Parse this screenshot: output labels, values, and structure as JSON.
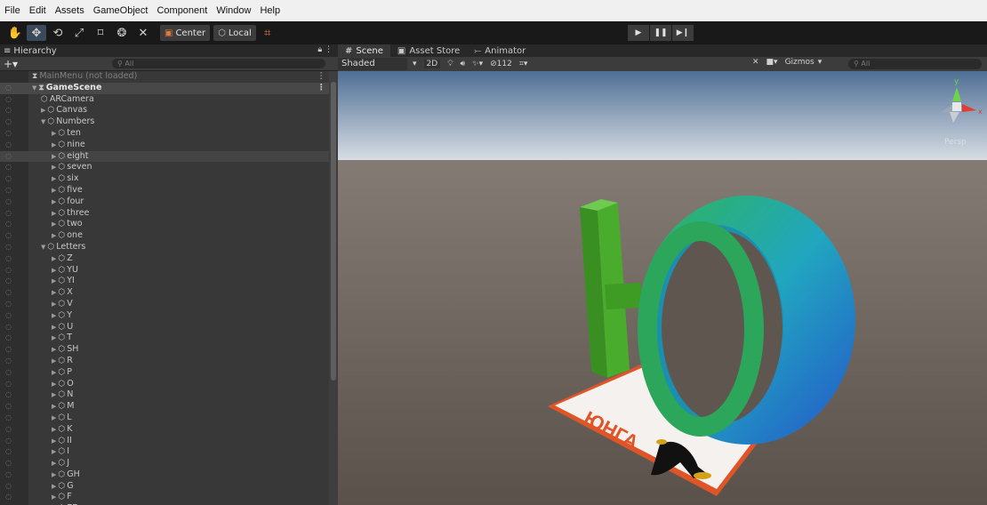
{
  "menu": [
    "File",
    "Edit",
    "Assets",
    "GameObject",
    "Component",
    "Window",
    "Help"
  ],
  "toolbar": {
    "center_label": "Center",
    "local_label": "Local"
  },
  "hierarchy": {
    "tab_label": "Hierarchy",
    "search_placeholder": "All",
    "rows": [
      {
        "label": "MainMenu (not loaded)",
        "depth": 0,
        "kind": "scene-unloaded",
        "menu": true
      },
      {
        "label": "GameScene",
        "depth": 0,
        "kind": "scene",
        "menu": true,
        "expanded": true
      },
      {
        "label": "ARCamera",
        "depth": 1,
        "kind": "object"
      },
      {
        "label": "Canvas",
        "depth": 1,
        "kind": "object",
        "collapsed": true
      },
      {
        "label": "Numbers",
        "depth": 1,
        "kind": "object",
        "expanded": true
      },
      {
        "label": "ten",
        "depth": 2,
        "kind": "object",
        "collapsed": true
      },
      {
        "label": "nine",
        "depth": 2,
        "kind": "object",
        "collapsed": true
      },
      {
        "label": "eight",
        "depth": 2,
        "kind": "object",
        "collapsed": true,
        "selected": true
      },
      {
        "label": "seven",
        "depth": 2,
        "kind": "object",
        "collapsed": true
      },
      {
        "label": "six",
        "depth": 2,
        "kind": "object",
        "collapsed": true
      },
      {
        "label": "five",
        "depth": 2,
        "kind": "object",
        "collapsed": true
      },
      {
        "label": "four",
        "depth": 2,
        "kind": "object",
        "collapsed": true
      },
      {
        "label": "three",
        "depth": 2,
        "kind": "object",
        "collapsed": true
      },
      {
        "label": "two",
        "depth": 2,
        "kind": "object",
        "collapsed": true
      },
      {
        "label": "one",
        "depth": 2,
        "kind": "object",
        "collapsed": true
      },
      {
        "label": "Letters",
        "depth": 1,
        "kind": "object",
        "expanded": true
      },
      {
        "label": "Z",
        "depth": 2,
        "kind": "object",
        "collapsed": true
      },
      {
        "label": "YU",
        "depth": 2,
        "kind": "object",
        "collapsed": true
      },
      {
        "label": "YI",
        "depth": 2,
        "kind": "object",
        "collapsed": true
      },
      {
        "label": "X",
        "depth": 2,
        "kind": "object",
        "collapsed": true
      },
      {
        "label": "V",
        "depth": 2,
        "kind": "object",
        "collapsed": true
      },
      {
        "label": "Y",
        "depth": 2,
        "kind": "object",
        "collapsed": true
      },
      {
        "label": "U",
        "depth": 2,
        "kind": "object",
        "collapsed": true
      },
      {
        "label": "T",
        "depth": 2,
        "kind": "object",
        "collapsed": true
      },
      {
        "label": "SH",
        "depth": 2,
        "kind": "object",
        "collapsed": true
      },
      {
        "label": "R",
        "depth": 2,
        "kind": "object",
        "collapsed": true
      },
      {
        "label": "P",
        "depth": 2,
        "kind": "object",
        "collapsed": true
      },
      {
        "label": "O",
        "depth": 2,
        "kind": "object",
        "collapsed": true
      },
      {
        "label": "N",
        "depth": 2,
        "kind": "object",
        "collapsed": true
      },
      {
        "label": "M",
        "depth": 2,
        "kind": "object",
        "collapsed": true
      },
      {
        "label": "L",
        "depth": 2,
        "kind": "object",
        "collapsed": true
      },
      {
        "label": "K",
        "depth": 2,
        "kind": "object",
        "collapsed": true
      },
      {
        "label": "II",
        "depth": 2,
        "kind": "object",
        "collapsed": true
      },
      {
        "label": "I",
        "depth": 2,
        "kind": "object",
        "collapsed": true
      },
      {
        "label": "J",
        "depth": 2,
        "kind": "object",
        "collapsed": true
      },
      {
        "label": "GH",
        "depth": 2,
        "kind": "object",
        "collapsed": true
      },
      {
        "label": "G",
        "depth": 2,
        "kind": "object",
        "collapsed": true
      },
      {
        "label": "F",
        "depth": 2,
        "kind": "object",
        "collapsed": true
      },
      {
        "label": "EE",
        "depth": 2,
        "kind": "object",
        "collapsed": true
      }
    ]
  },
  "scene": {
    "tabs": [
      {
        "label": "Scene",
        "icon": "grid-icon",
        "active": true
      },
      {
        "label": "Asset Store",
        "icon": "bag-icon",
        "active": false
      },
      {
        "label": "Animator",
        "icon": "animator-icon",
        "active": false
      }
    ],
    "shading_mode": "Shaded",
    "mode_2d": "2D",
    "hidden_count": "112",
    "gizmos_label": "Gizmos",
    "search_placeholder": "All",
    "persp_label": "Persp",
    "axis_y": "y",
    "axis_x": "x",
    "card_text": "ЮНГА"
  },
  "colors": {
    "menubar_bg": "#f0f0f0",
    "toolbar_bg": "#191919",
    "panel_bg": "#383838",
    "selection_bg": "#444444",
    "sky_top": "#4f6f95",
    "sky_bottom": "#d7dde3",
    "ground": "#615851",
    "letter_green": "#3c9c28",
    "letter_blue": "#2e8fd6"
  }
}
